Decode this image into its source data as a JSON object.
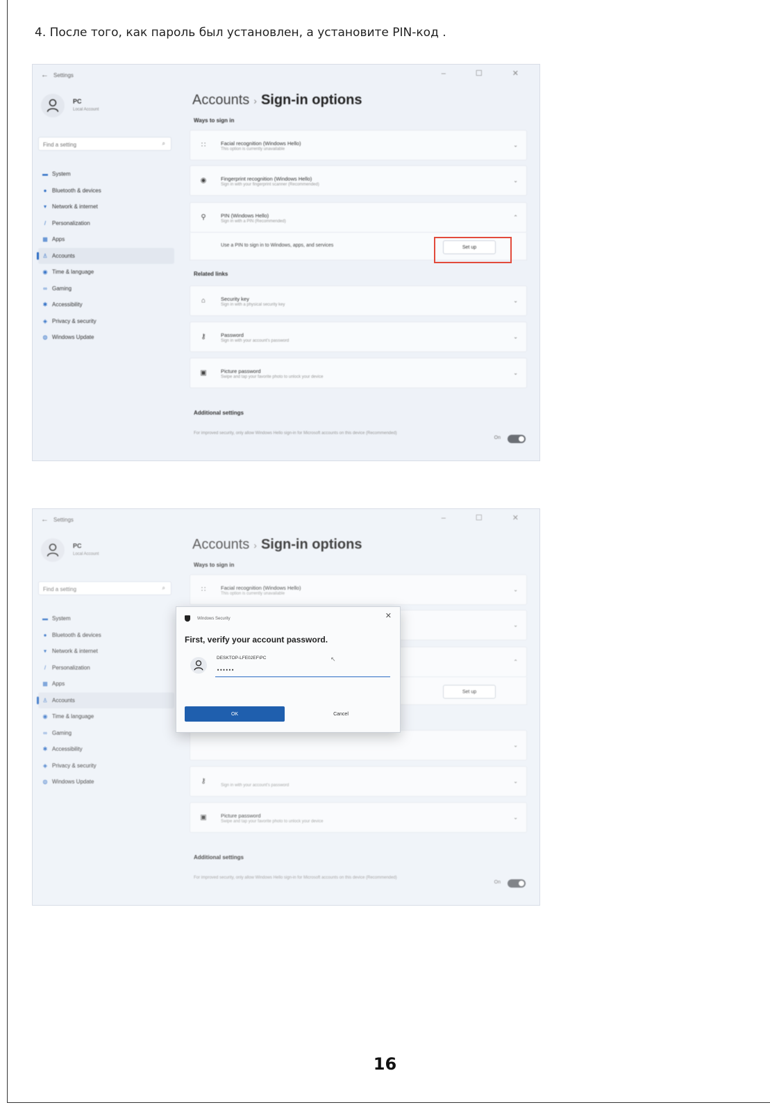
{
  "instruction": "4. После того, как пароль был установлен, а установите PIN-код .",
  "page_number": "16",
  "settings": {
    "app_title": "Settings",
    "window_controls": "– ☐ ✕",
    "profile": {
      "name": "PC",
      "sub": "Local Account"
    },
    "search_placeholder": "Find a setting",
    "nav": [
      {
        "label": "System",
        "icon": "monitor-icon"
      },
      {
        "label": "Bluetooth & devices",
        "icon": "bluetooth-icon"
      },
      {
        "label": "Network & internet",
        "icon": "wifi-icon"
      },
      {
        "label": "Personalization",
        "icon": "brush-icon"
      },
      {
        "label": "Apps",
        "icon": "apps-icon"
      },
      {
        "label": "Accounts",
        "icon": "person-icon",
        "active": true
      },
      {
        "label": "Time & language",
        "icon": "globe-icon"
      },
      {
        "label": "Gaming",
        "icon": "gamepad-icon"
      },
      {
        "label": "Accessibility",
        "icon": "accessibility-icon"
      },
      {
        "label": "Privacy & security",
        "icon": "shield-icon"
      },
      {
        "label": "Windows Update",
        "icon": "update-icon"
      }
    ],
    "breadcrumb": {
      "parent": "Accounts",
      "separator": "›",
      "current": "Sign-in options"
    },
    "ways_label": "Ways to sign in",
    "options": [
      {
        "title": "Facial recognition (Windows Hello)",
        "sub": "This option is currently unavailable",
        "icon": "face-icon",
        "chevron": "⌄"
      },
      {
        "title": "Fingerprint recognition (Windows Hello)",
        "sub": "Sign in with your fingerprint scanner (Recommended)",
        "icon": "fingerprint-icon",
        "chevron": "⌄"
      },
      {
        "title": "PIN (Windows Hello)",
        "sub": "Sign in with a PIN (Recommended)",
        "icon": "pin-icon",
        "chevron": "⌃"
      }
    ],
    "pin_text": "Use a PIN to sign in to Windows, apps, and services",
    "setup_label": "Set up",
    "related_label": "Related links",
    "related": [
      {
        "title": "Security key",
        "sub": "Sign in with a physical security key",
        "icon": "key-icon",
        "chevron": "⌄"
      },
      {
        "title": "Password",
        "sub": "Sign in with your account's password",
        "icon": "password-icon",
        "chevron": "⌄"
      },
      {
        "title": "Picture password",
        "sub": "Swipe and tap your favorite photo to unlock your device",
        "icon": "picture-icon",
        "chevron": "⌄"
      }
    ],
    "additional_label": "Additional settings",
    "additional_text": "For improved security, only allow Windows Hello sign-in for Microsoft accounts on this device (Recommended)",
    "toggle_label": "On"
  },
  "dialog": {
    "app": "Windows Security",
    "close": "✕",
    "heading": "First, verify your account password.",
    "account": "DESKTOP-LFE02EF\\PC",
    "password_value": "••••••",
    "ok_label": "OK",
    "cancel_label": "Cancel"
  },
  "colors": {
    "highlight": "#e24a3b",
    "accent": "#2b6cc4",
    "ok_button": "#1f5fae"
  }
}
